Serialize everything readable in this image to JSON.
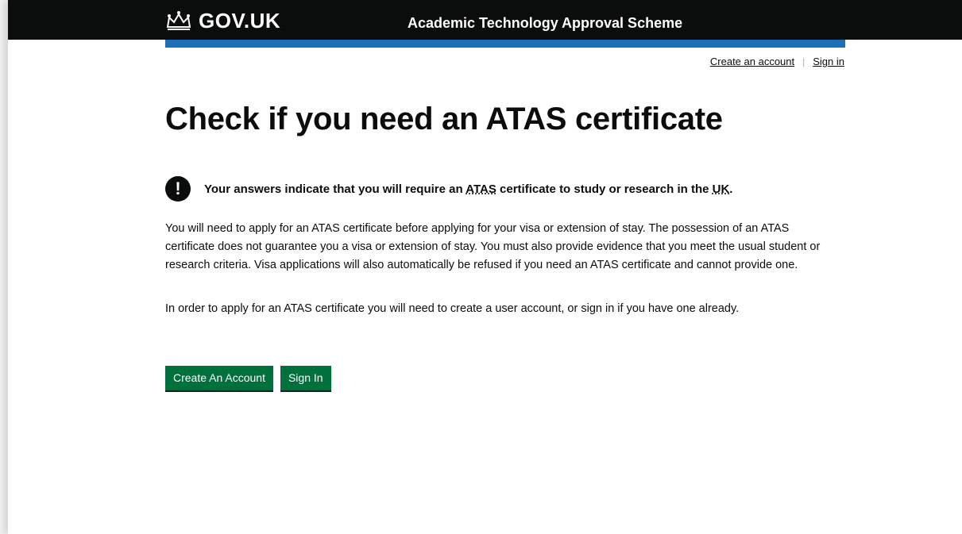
{
  "header": {
    "logo_text": "GOV.UK",
    "service_name": "Academic Technology Approval Scheme"
  },
  "top_links": {
    "create_account": "Create an account",
    "separator": "|",
    "sign_in": "Sign in"
  },
  "main": {
    "title": "Check if you need an ATAS certificate",
    "warning": {
      "icon": "!",
      "text_before": "Your answers indicate that you will require an ",
      "abbr_atas": "ATAS",
      "text_middle": " certificate to study or research in the ",
      "abbr_uk": "UK",
      "text_after": "."
    },
    "paragraph1": "You will need to apply for an ATAS certificate before applying for your visa or extension of stay. The possession of an ATAS certificate does not guarantee you a visa or extension of stay. You must also provide evidence that you meet the usual student or research criteria. Visa applications will also automatically be refused if you need an ATAS certificate and cannot provide one.",
    "paragraph2": "In order to apply for an ATAS certificate you will need to create a user account, or sign in if you have one already."
  },
  "buttons": {
    "create_account": "Create An Account",
    "sign_in": "Sign In"
  },
  "colors": {
    "header_bg": "#0b0c0c",
    "accent_blue": "#1d70b8",
    "button_green": "#00703c"
  },
  "icons": {
    "logo": "crown-icon",
    "warning": "warning-icon"
  }
}
